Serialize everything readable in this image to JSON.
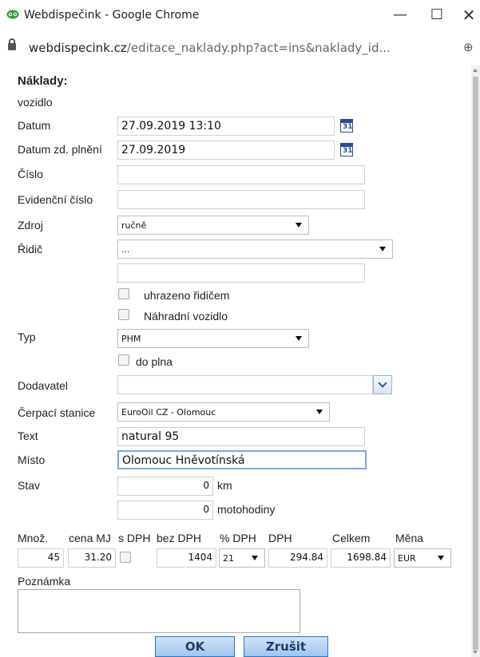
{
  "browser": {
    "window_title": "Webdispečink - Google Chrome",
    "url_domain": "webdispecink.cz",
    "url_path": "/editace_naklady.php?act=ins&naklady_id...",
    "controls": {
      "minimize": "—",
      "maximize": "☐",
      "close": "✕"
    },
    "zoom_glyph": "⊕"
  },
  "form": {
    "heading": "Náklady:",
    "labels": {
      "vozidlo": "vozidlo",
      "datum": "Datum",
      "datum_zd": "Datum zd. plnění",
      "cislo": "Číslo",
      "evidencni": "Evidenční číslo",
      "zdroj": "Zdroj",
      "ridic": "Řidič",
      "typ": "Typ",
      "dodavatel": "Dodavatel",
      "cerpaci": "Čerpací stanice",
      "text": "Text",
      "misto": "Místo",
      "stav": "Stav",
      "poznamka": "Poznámka"
    },
    "values": {
      "datum": "27.09.2019 13:10",
      "datum_zd": "27.09.2019",
      "cislo": "",
      "evidencni": "",
      "zdroj": "ručně",
      "ridic": "...",
      "ridic_extra": "",
      "typ": "PHM",
      "dodavatel": "",
      "cerpaci": "EuroOil CZ - Olomouc",
      "text": "natural 95",
      "misto": "Olomouc Hněvotínská",
      "stav_km": "0",
      "stav_mh": "0"
    },
    "calendar_day": "31",
    "checkboxes": {
      "uhrazeno": "uhrazeno řidičem",
      "nahradni": "Náhradní vozidlo",
      "do_plna": "do plna"
    },
    "units": {
      "km": "km",
      "motohodiny": "motohodiny"
    },
    "price_headers": {
      "mnoz": "Množ.",
      "cena": "cena MJ",
      "sdph": "s DPH",
      "bezdph": "bez DPH",
      "pdph": "% DPH",
      "dph": "DPH",
      "celkem": "Celkem",
      "mena": "Měna"
    },
    "price_values": {
      "mnoz": "45",
      "cena": "31.20",
      "bezdph": "1404",
      "pdph": "21",
      "dph": "294.84",
      "celkem": "1698.84",
      "mena": "EUR"
    },
    "buttons": {
      "ok": "OK",
      "cancel": "Zrušit"
    }
  },
  "colors": {
    "accent": "#2b78c5",
    "calendar": "#2b4d8a",
    "focus": "#7aa7e0"
  }
}
